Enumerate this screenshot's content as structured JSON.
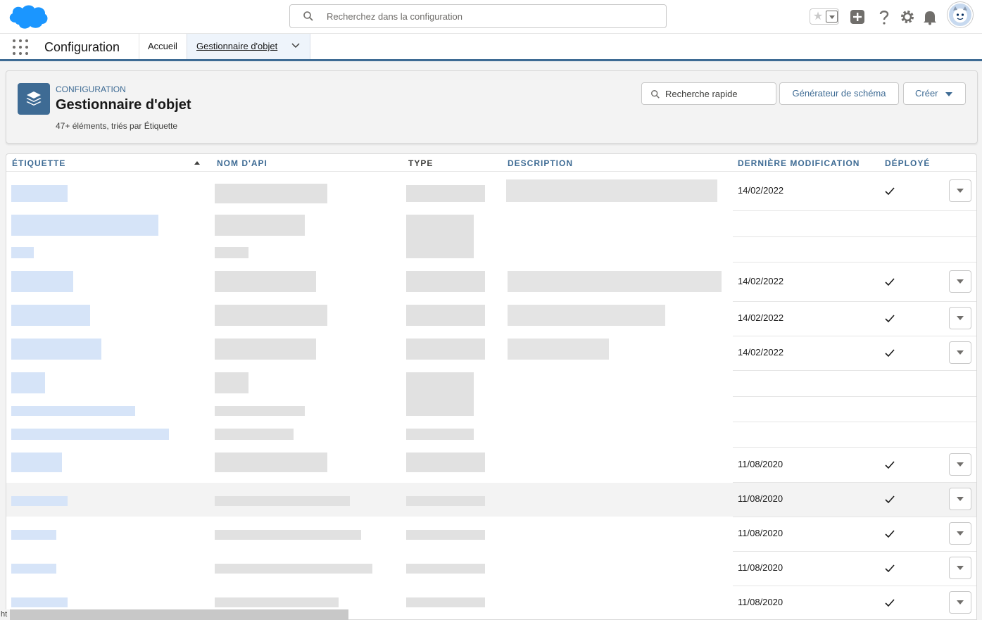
{
  "topbar": {
    "search_placeholder": "Recherchez dans la configuration",
    "icons": [
      "salesforce-logo",
      "search-icon",
      "star-icon",
      "chevron-down-icon",
      "add-icon",
      "help-icon",
      "gear-icon",
      "bell-icon",
      "avatar"
    ]
  },
  "nav": {
    "app_name": "Configuration",
    "home_label": "Accueil",
    "active_tab_label": "Gestionnaire d'objet"
  },
  "header": {
    "eyebrow": "CONFIGURATION",
    "title": "Gestionnaire d'objet",
    "subtitle": "47+ éléments, triés par Étiquette",
    "quick_search_placeholder": "Recherche rapide",
    "schema_button": "Générateur de schéma",
    "create_button": "Créer"
  },
  "table": {
    "columns": [
      "ÉTIQUETTE",
      "NOM D'API",
      "TYPE",
      "DESCRIPTION",
      "DERNIÈRE MODIFICATION",
      "DÉPLOYÉ"
    ],
    "rows": [
      {
        "modified": "14/02/2022",
        "deployed": true
      },
      {
        "modified": "",
        "deployed": false
      },
      {
        "modified": "",
        "deployed": false
      },
      {
        "modified": "14/02/2022",
        "deployed": true
      },
      {
        "modified": "14/02/2022",
        "deployed": true
      },
      {
        "modified": "14/02/2022",
        "deployed": true
      },
      {
        "modified": "",
        "deployed": false
      },
      {
        "modified": "",
        "deployed": false
      },
      {
        "modified": "",
        "deployed": false
      },
      {
        "modified": "11/08/2020",
        "deployed": true
      },
      {
        "modified": "11/08/2020",
        "deployed": true
      },
      {
        "modified": "11/08/2020",
        "deployed": true
      },
      {
        "modified": "11/08/2020",
        "deployed": true
      },
      {
        "modified": "11/08/2020",
        "deployed": true
      }
    ]
  },
  "statusbar": {
    "text": "ht"
  },
  "colors": {
    "brand_blue": "#3e6b94",
    "salesforce_cloud": "#1b96ff"
  }
}
